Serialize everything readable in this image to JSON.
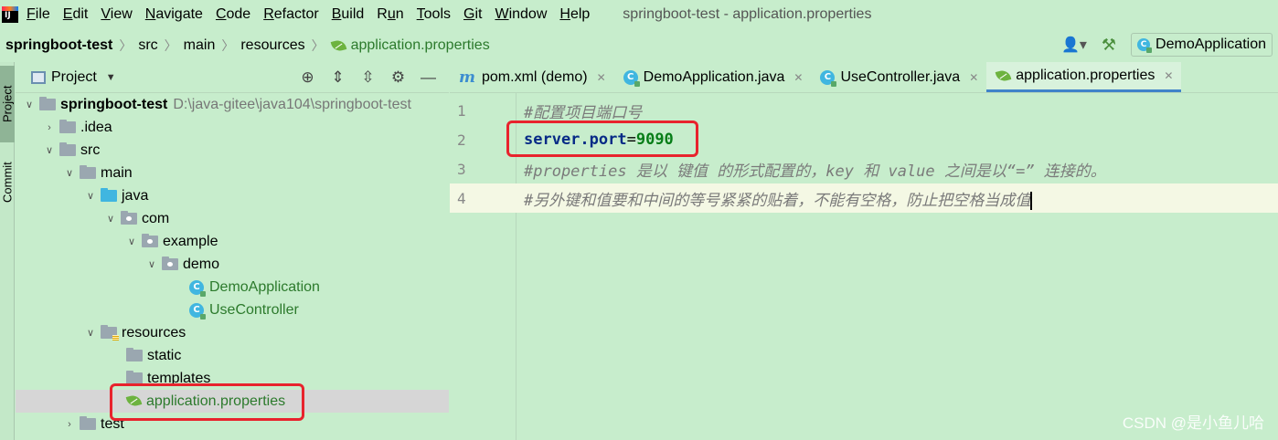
{
  "menu": {
    "items": [
      {
        "pre": "",
        "u": "F",
        "post": "ile"
      },
      {
        "pre": "",
        "u": "E",
        "post": "dit"
      },
      {
        "pre": "",
        "u": "V",
        "post": "iew"
      },
      {
        "pre": "",
        "u": "N",
        "post": "avigate"
      },
      {
        "pre": "",
        "u": "C",
        "post": "ode"
      },
      {
        "pre": "",
        "u": "R",
        "post": "efactor"
      },
      {
        "pre": "",
        "u": "B",
        "post": "uild"
      },
      {
        "pre": "R",
        "u": "u",
        "post": "n"
      },
      {
        "pre": "",
        "u": "T",
        "post": "ools"
      },
      {
        "pre": "",
        "u": "G",
        "post": "it"
      },
      {
        "pre": "",
        "u": "W",
        "post": "indow"
      },
      {
        "pre": "",
        "u": "H",
        "post": "elp"
      }
    ],
    "window_title": "springboot-test - application.properties"
  },
  "breadcrumb": [
    "springboot-test",
    "src",
    "main",
    "resources",
    "application.properties"
  ],
  "run_config": "DemoApplication",
  "sidebar_strip": {
    "project": "Project",
    "commit": "Commit"
  },
  "project_panel": {
    "title": "Project"
  },
  "tree": {
    "root_name": "springboot-test",
    "root_path": "D:\\java-gitee\\java104\\springboot-test",
    "idea": ".idea",
    "src": "src",
    "main": "main",
    "java": "java",
    "com": "com",
    "example": "example",
    "demo": "demo",
    "demo_app": "DemoApplication",
    "use_ctrl": "UseController",
    "resources": "resources",
    "static": "static",
    "templates": "templates",
    "app_props": "application.properties",
    "test": "test"
  },
  "tabs": [
    {
      "label": "pom.xml (demo)",
      "icon": "maven-icon",
      "active": false
    },
    {
      "label": "DemoApplication.java",
      "icon": "class-icon",
      "active": false
    },
    {
      "label": "UseController.java",
      "icon": "class-icon",
      "active": false
    },
    {
      "label": "application.properties",
      "icon": "spring-leaf-icon",
      "active": true
    }
  ],
  "editor": {
    "lines": [
      {
        "no": "1",
        "comment": "#配置项目端口号"
      },
      {
        "no": "2",
        "key": "server.port",
        "eq": "=",
        "value": "9090"
      },
      {
        "no": "3",
        "comment": "#properties 是以 键值 的形式配置的，key 和 value 之间是以“=” 连接的。"
      },
      {
        "no": "4",
        "comment": "#另外键和值要和中间的等号紧紧的贴着，不能有空格，防止把空格当成值"
      }
    ]
  },
  "watermark": "CSDN @是小鱼儿哈",
  "colors": {
    "background": "#c7edcc",
    "highlight_box": "#e8232d",
    "tab_underline": "#4083c9"
  }
}
